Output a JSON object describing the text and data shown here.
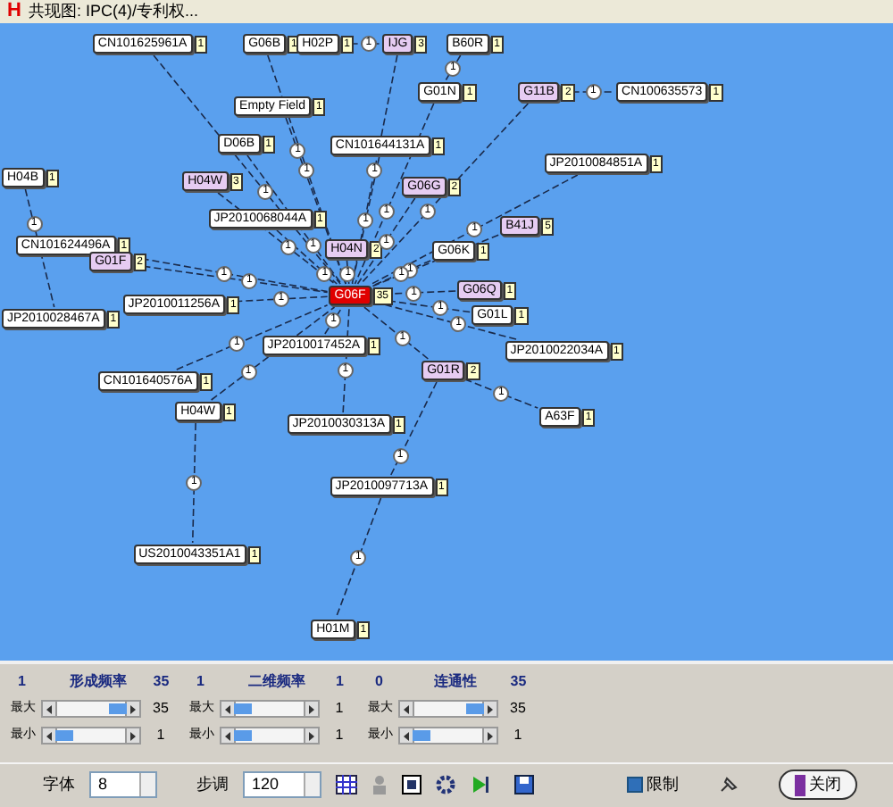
{
  "window": {
    "app_icon": "H",
    "title": "共现图: IPC(4)/专利权..."
  },
  "graph": {
    "nodes": [
      {
        "label": "CN101625961A",
        "count": "1",
        "color": "#ffffff"
      },
      {
        "label": "G06B",
        "count": "1",
        "color": "#ffffff"
      },
      {
        "label": "H02P",
        "count": "1",
        "color": "#ffffff"
      },
      {
        "label": "IJG",
        "count": "3",
        "color": "#e6ccf2"
      },
      {
        "label": "B60R",
        "count": "1",
        "color": "#ffffff"
      },
      {
        "label": "G01N",
        "count": "1",
        "color": "#ffffff"
      },
      {
        "label": "G11B",
        "count": "2",
        "color": "#e6ccf2"
      },
      {
        "label": "CN100635573",
        "count": "1",
        "color": "#ffffff"
      },
      {
        "label": "Empty Field",
        "count": "1",
        "color": "#ffffff"
      },
      {
        "label": "D06B",
        "count": "1",
        "color": "#ffffff"
      },
      {
        "label": "CN101644131A",
        "count": "1",
        "color": "#ffffff"
      },
      {
        "label": "JP2010084851A",
        "count": "1",
        "color": "#ffffff"
      },
      {
        "label": "H04B",
        "count": "1",
        "color": "#ffffff"
      },
      {
        "label": "H04W",
        "count": "3",
        "color": "#e6ccf2"
      },
      {
        "label": "G06G",
        "count": "2",
        "color": "#e6ccf2"
      },
      {
        "label": "JP2010068044A",
        "count": "1",
        "color": "#ffffff"
      },
      {
        "label": "B41J",
        "count": "5",
        "color": "#e6ccf2"
      },
      {
        "label": "CN101624496A",
        "count": "1",
        "color": "#ffffff"
      },
      {
        "label": "H04N",
        "count": "2",
        "color": "#e6ccf2"
      },
      {
        "label": "G06K",
        "count": "1",
        "color": "#ffffff"
      },
      {
        "label": "G01F",
        "count": "2",
        "color": "#e6ccf2"
      },
      {
        "label": "G06Q",
        "count": "1",
        "color": "#e6ccf2"
      },
      {
        "label": "G06F",
        "count": "35",
        "color": "#e00000"
      },
      {
        "label": "JP2010011256A",
        "count": "1",
        "color": "#ffffff"
      },
      {
        "label": "G01L",
        "count": "1",
        "color": "#ffffff"
      },
      {
        "label": "JP2010028467A",
        "count": "1",
        "color": "#ffffff"
      },
      {
        "label": "JP2010017452A",
        "count": "1",
        "color": "#ffffff"
      },
      {
        "label": "JP2010022034A",
        "count": "1",
        "color": "#ffffff"
      },
      {
        "label": "G01R",
        "count": "2",
        "color": "#e6ccf2"
      },
      {
        "label": "CN101640576A",
        "count": "1",
        "color": "#ffffff"
      },
      {
        "label": "H04W",
        "count": "1",
        "color": "#ffffff"
      },
      {
        "label": "A63F",
        "count": "1",
        "color": "#ffffff"
      },
      {
        "label": "JP2010030313A",
        "count": "1",
        "color": "#ffffff"
      },
      {
        "label": "JP2010097713A",
        "count": "1",
        "color": "#ffffff"
      },
      {
        "label": "US2010043351A1",
        "count": "1",
        "color": "#ffffff"
      },
      {
        "label": "H01M",
        "count": "1",
        "color": "#ffffff"
      }
    ],
    "edges": [
      {
        "weight": "1"
      },
      {
        "weight": "1"
      },
      {
        "weight": "1"
      },
      {
        "weight": "1"
      },
      {
        "weight": "1"
      },
      {
        "weight": "1"
      },
      {
        "weight": "1"
      },
      {
        "weight": "1"
      },
      {
        "weight": "1"
      },
      {
        "weight": "1"
      },
      {
        "weight": "1"
      },
      {
        "weight": "1"
      },
      {
        "weight": "1"
      },
      {
        "weight": "1"
      },
      {
        "weight": "1"
      },
      {
        "weight": "1"
      },
      {
        "weight": "1"
      },
      {
        "weight": "1"
      },
      {
        "weight": "1"
      },
      {
        "weight": "1"
      },
      {
        "weight": "1"
      },
      {
        "weight": "1"
      },
      {
        "weight": "1"
      },
      {
        "weight": "1"
      },
      {
        "weight": "1"
      },
      {
        "weight": "1"
      },
      {
        "weight": "1"
      },
      {
        "weight": "1"
      },
      {
        "weight": "1"
      },
      {
        "weight": "1"
      },
      {
        "weight": "1"
      },
      {
        "weight": "1"
      },
      {
        "weight": "1"
      },
      {
        "weight": "1"
      }
    ]
  },
  "filters": [
    {
      "title": "形成频率",
      "range_min": "1",
      "range_max": "35",
      "max": {
        "label": "最大",
        "level": 0.9,
        "value": "35"
      },
      "min": {
        "label": "最小",
        "level": 0.1,
        "value": "1"
      }
    },
    {
      "title": "二维频率",
      "range_min": "1",
      "range_max": "1",
      "max": {
        "label": "最大",
        "level": 0.1,
        "value": "1"
      },
      "min": {
        "label": "最小",
        "level": 0.1,
        "value": "1"
      }
    },
    {
      "title": "连通性",
      "range_min": "0",
      "range_max": "35",
      "max": {
        "label": "最大",
        "level": 0.9,
        "value": "35"
      },
      "min": {
        "label": "最小",
        "level": 0.1,
        "value": "1"
      }
    }
  ],
  "controls": {
    "font": {
      "label": "字体",
      "value": "8"
    },
    "step": {
      "label": "步调",
      "value": "120"
    },
    "limit": {
      "label": "限制",
      "checked": true
    },
    "close_button": "关闭"
  }
}
